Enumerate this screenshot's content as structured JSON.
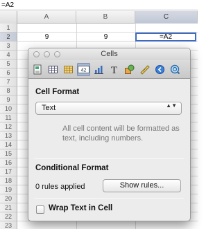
{
  "formula_bar": {
    "value": "=A2"
  },
  "sheet": {
    "columns": [
      "A",
      "B",
      "C"
    ],
    "selected_column": "C",
    "rows": [
      "1",
      "2",
      "3",
      "4",
      "5",
      "6",
      "7",
      "8",
      "9",
      "10",
      "11",
      "12",
      "13",
      "14",
      "15",
      "16",
      "17",
      "18",
      "19",
      "20",
      "21",
      "22",
      "23"
    ],
    "selected_row": "2",
    "cells": {
      "A2": "9",
      "B2": "9",
      "C2": "=A2"
    }
  },
  "panel": {
    "title": "Cells",
    "toolbar_icons": [
      "document-icon",
      "table-icon",
      "table-cell-icon",
      "cell-format-icon",
      "chart-icon",
      "text-icon",
      "shapes-icon",
      "ruler-icon",
      "link-icon",
      "quicktime-icon"
    ],
    "selected_tool": "cell-format-icon",
    "cell_format_number": "42",
    "text_icon_glyph": "T",
    "cell_format_title": "Cell Format",
    "format_select_value": "Text",
    "format_select_arrows": "▲▼",
    "format_description": "All cell content will be formatted as text, including numbers.",
    "conditional_format_title": "Conditional Format",
    "rules_applied": "0 rules applied",
    "show_rules_button": "Show rules...",
    "wrap_text_label": "Wrap Text in Cell",
    "wrap_text_checked": false
  },
  "colors": {
    "selection_border": "#3d6bbd",
    "panel_bg": "#ececec",
    "selected_tool_bg": "#a9b7cf"
  }
}
